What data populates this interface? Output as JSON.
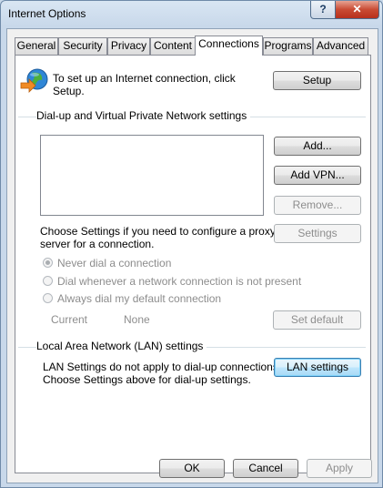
{
  "window": {
    "title": "Internet Options",
    "help_label": "?",
    "close_label": "✕"
  },
  "tabs": [
    "General",
    "Security",
    "Privacy",
    "Content",
    "Connections",
    "Programs",
    "Advanced"
  ],
  "active_tab": "Connections",
  "setup": {
    "text_line1": "To set up an Internet connection, click",
    "text_line2": "Setup.",
    "button": "Setup"
  },
  "dialup": {
    "group_label": "Dial-up and Virtual Private Network settings",
    "add_button": "Add...",
    "add_vpn_button": "Add VPN...",
    "remove_button": "Remove...",
    "proxy_text_line1": "Choose Settings if you need to configure a proxy",
    "proxy_text_line2": "server for a connection.",
    "settings_button": "Settings",
    "options": [
      {
        "label": "Never dial a connection",
        "checked": true
      },
      {
        "label": "Dial whenever a network connection is not present",
        "checked": false
      },
      {
        "label": "Always dial my default connection",
        "checked": false
      }
    ],
    "current_label": "Current",
    "current_value": "None",
    "set_default_button": "Set default"
  },
  "lan": {
    "group_label": "Local Area Network (LAN) settings",
    "text_line1": "LAN Settings do not apply to dial-up connections.",
    "text_line2": "Choose Settings above for dial-up settings.",
    "button": "LAN settings"
  },
  "footer": {
    "ok": "OK",
    "cancel": "Cancel",
    "apply": "Apply"
  },
  "icons": {
    "setup": "globe-network-icon"
  }
}
